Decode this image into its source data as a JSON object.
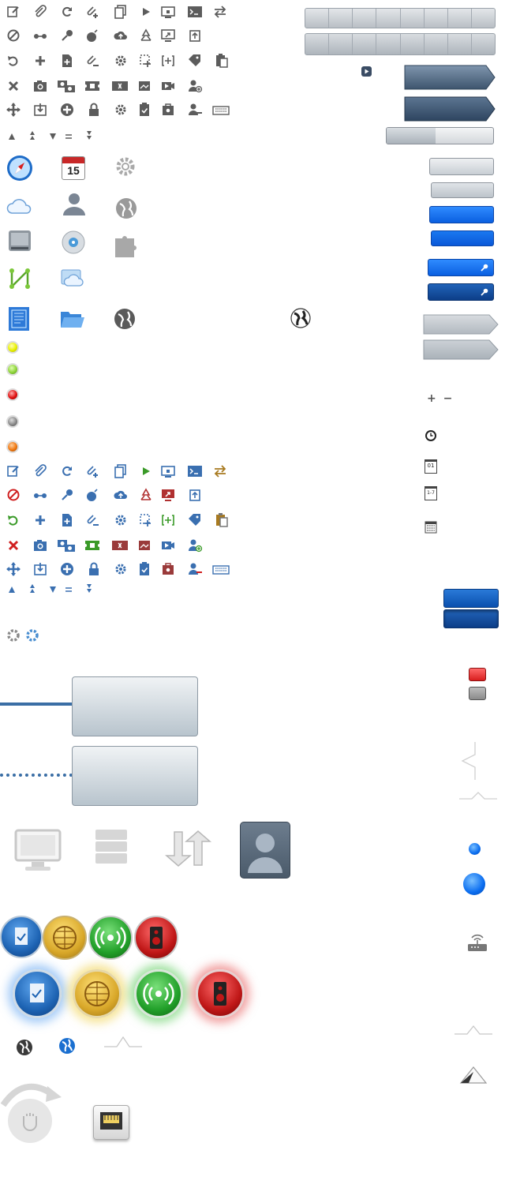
{
  "sprite": {
    "toolbar_icons_gray": [
      "edit-icon",
      "attachment-icon",
      "refresh-icon",
      "attach-add-icon",
      "copy-icon",
      "play-icon",
      "lock-screen-icon",
      "terminal-icon",
      "swap-icon",
      "block-icon",
      "connect-icon",
      "key-icon",
      "bomb-icon",
      "cloud-upload-icon",
      "recycle-icon",
      "remote-desktop-icon",
      "upload-icon",
      "undo-icon",
      "add-icon",
      "add-file-icon",
      "attach-remove-icon",
      "settings-icon",
      "select-icon",
      "expand-icon",
      "tag-icon",
      "paste-icon",
      "delete-icon",
      "camera-icon",
      "camera-group-icon",
      "ticket-icon",
      "film-icon",
      "image-icon",
      "video-icon",
      "user-add-icon",
      "move-icon",
      "download-icon",
      "add-circle-icon",
      "lock-icon",
      "gear-icon",
      "clipboard-check-icon",
      "briefcase-icon",
      "user-remove-icon",
      "keyboard-icon"
    ],
    "small_arrows": [
      "triangle-up-icon",
      "double-up-icon",
      "triangle-down-icon",
      "equals-icon",
      "double-down-icon"
    ],
    "app_icons": [
      "safari-compass-icon",
      "calendar-icon",
      "gear-icon",
      "icloud-icon",
      "user-silhouette-icon",
      "globe-icon",
      "hard-drive-icon",
      "disk-utility-icon",
      "puzzle-icon",
      "network-graph-icon",
      "cloud-folder-icon",
      "blueprint-icon",
      "folder-open-icon",
      "globe-icon",
      "globe-small-icon"
    ],
    "status_dots": [
      {
        "name": "status-yellow",
        "color": "#e8f000"
      },
      {
        "name": "status-green",
        "color": "#8fd43a"
      },
      {
        "name": "status-red",
        "color": "#e01010"
      },
      {
        "name": "status-gray",
        "color": "#8a8a8a"
      },
      {
        "name": "status-orange",
        "color": "#f07810"
      }
    ],
    "calendar_day": "15",
    "date_icons": [
      "01",
      "1-7"
    ],
    "plus_minus": "+ −",
    "colors": {
      "accent_blue": "#0a6df0",
      "dark_blue": "#0c3e88",
      "slate": "#4a6078",
      "icon_gray": "#5c5c5c",
      "icon_blue": "#3a6fb0",
      "icon_green": "#3a9a28",
      "icon_red": "#b03030",
      "line_blue": "#3a6ea5",
      "medal_blue": "#1e64b4",
      "medal_gold": "#d9a82a",
      "medal_green": "#22a02a",
      "medal_red": "#c01818"
    }
  }
}
